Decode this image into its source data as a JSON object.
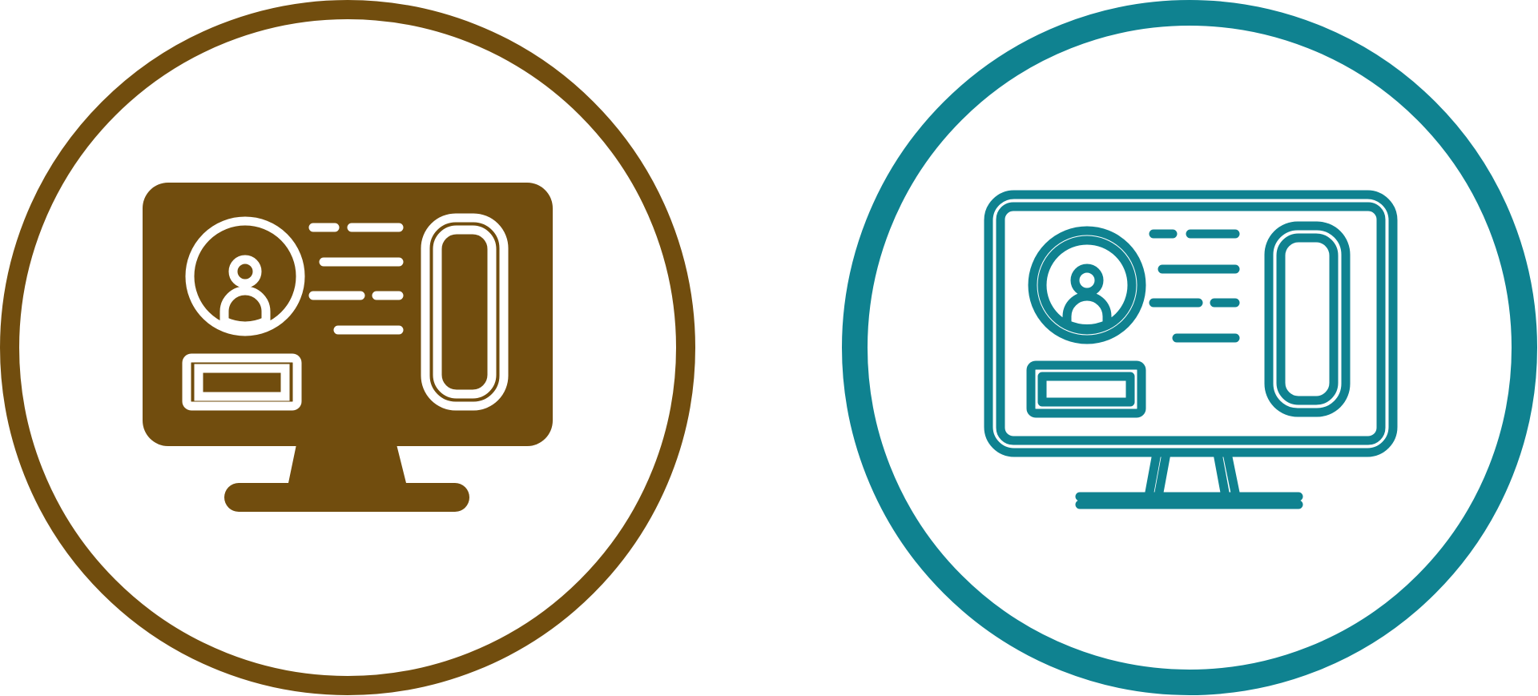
{
  "icons": [
    {
      "id": "glyph",
      "style": "glyph",
      "subject": "user-profile-monitor-icon",
      "color": "#714d0e",
      "background": "#ffffff"
    },
    {
      "id": "line",
      "style": "outline",
      "subject": "user-profile-monitor-icon",
      "color": "#0f8290",
      "background": "#ffffff"
    }
  ]
}
